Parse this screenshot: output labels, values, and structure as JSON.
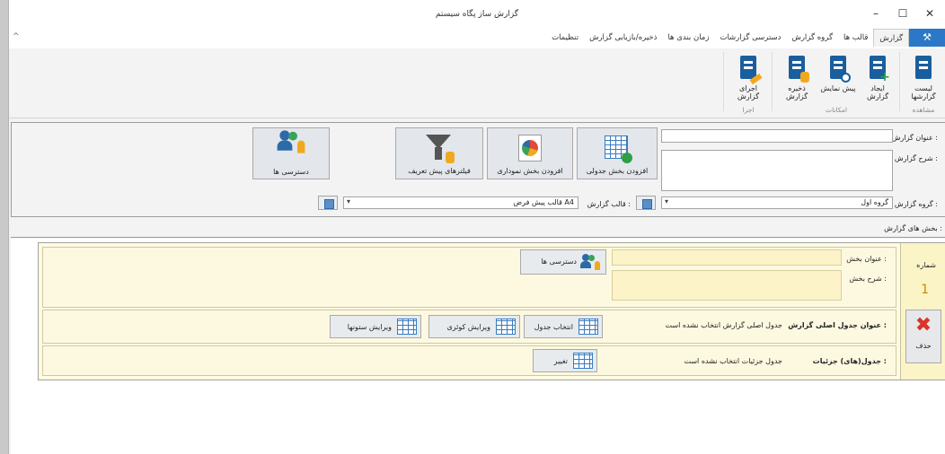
{
  "window": {
    "title": "گزارش ساز پگاه سیستم",
    "min_glyph": "–",
    "max_glyph": "☐",
    "close_glyph": "✕",
    "collapse_glyph": "^"
  },
  "tabs": {
    "file_glyph": "⚒",
    "items": [
      {
        "label": "گزارش",
        "active": true
      },
      {
        "label": "قالب ها"
      },
      {
        "label": "گروه گزارش"
      },
      {
        "label": "دسترسی گزارشات"
      },
      {
        "label": "زمان بندی ها"
      },
      {
        "label": "ذخیره/بازیابی گزارش"
      },
      {
        "label": "تنظیمات"
      }
    ]
  },
  "ribbon": {
    "buttons": {
      "list": "لیست گزارشها",
      "create": "ایجاد گزارش",
      "preview": "پیش نمایش",
      "save": "ذخیره گزارش",
      "run": "اجرای گزارش"
    },
    "groups": {
      "view": "مشاهده",
      "features": "امکانات",
      "execute": "اجرا"
    }
  },
  "form": {
    "title_label": "عنوان گزارش :",
    "title_value": "",
    "desc_label": "شرح گزارش :",
    "desc_value": "",
    "group_label": "گروه گزارش :",
    "group_value": "گروه اول",
    "template_label": "قالب گزارش :",
    "template_value": "قالب پیش فرض A4",
    "add_table": "افزودن بخش جدولی",
    "add_chart": "افزودن بخش نموداری",
    "filters": "فیلترهای پیش تعریف",
    "access": "دسترسی ها",
    "footer_label": "بخش های گزارش :"
  },
  "section": {
    "number_label": "شماره",
    "number_value": "1",
    "delete_label": "حذف",
    "section_title_label": "عنوان بخش :",
    "section_desc_label": "شرح بخش :",
    "access_btn": "دسترسی ها",
    "main_table_label": "عنوان جدول اصلی گزارش :",
    "main_table_value": "جدول اصلی گزارش انتخاب نشده است",
    "select_table_btn": "انتخاب جدول",
    "edit_query_btn": "ویرایش کوئری",
    "edit_columns_btn": "ویرایش ستونها",
    "detail_label": "جدول(های) جزئیات :",
    "detail_value": "جدول جزئیات انتخاب نشده است",
    "change_btn": "تغییر"
  }
}
